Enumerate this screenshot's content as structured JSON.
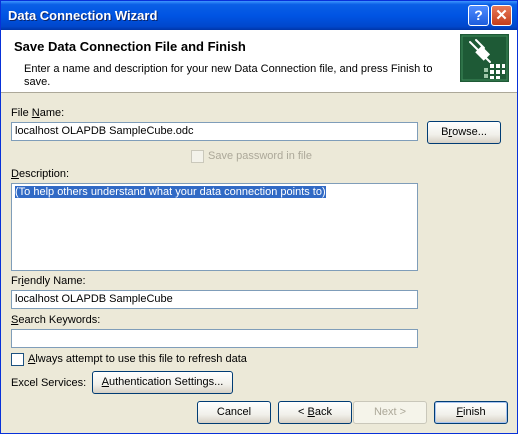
{
  "window": {
    "title": "Data Connection Wizard"
  },
  "header": {
    "title": "Save Data Connection File and Finish",
    "description": "Enter a name and description for your new Data Connection file, and press Finish to save."
  },
  "form": {
    "file_name_label_pre": "File ",
    "file_name_label_ul": "N",
    "file_name_label_post": "ame:",
    "file_name_value": "localhost OLAPDB SampleCube.odc",
    "browse_pre": "B",
    "browse_ul": "r",
    "browse_post": "owse...",
    "save_password_label": "Save password in file",
    "description_label_ul": "D",
    "description_label_post": "escription:",
    "description_value": "(To help others understand what your data connection points to)",
    "friendly_name_label_pre": "Fr",
    "friendly_name_label_ul": "i",
    "friendly_name_label_post": "endly Name:",
    "friendly_name_value": "localhost OLAPDB SampleCube",
    "search_keywords_label_ul": "S",
    "search_keywords_label_post": "earch Keywords:",
    "search_keywords_value": "",
    "always_use_ul": "A",
    "always_use_post": "lways attempt to use this file to refresh data",
    "excel_services_label": "Excel Services:",
    "auth_ul": "A",
    "auth_post": "uthentication Settings..."
  },
  "footer": {
    "cancel": "Cancel",
    "back_pre": "< ",
    "back_ul": "B",
    "back_post": "ack",
    "next": "Next >",
    "finish_ul": "F",
    "finish_post": "inish"
  }
}
